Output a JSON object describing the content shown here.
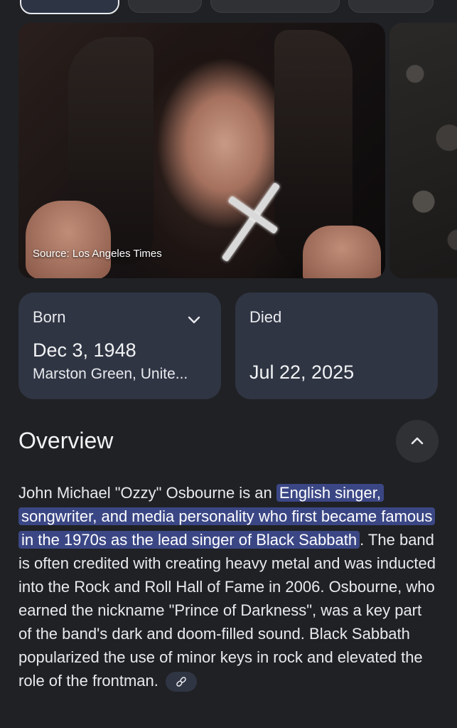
{
  "image": {
    "source_label": "Source: Los Angeles Times"
  },
  "facts": {
    "born": {
      "label": "Born",
      "date": "Dec 3, 1948",
      "place": "Marston Green, Unite..."
    },
    "died": {
      "label": "Died",
      "date": "Jul 22, 2025"
    }
  },
  "overview": {
    "title": "Overview",
    "text_before": "John Michael \"Ozzy\" Osbourne is an ",
    "highlight": "English singer, songwriter, and media personality who first became famous in the 1970s as the lead singer of Black Sabbath",
    "text_after": ". The band is often credited with creating heavy metal and was inducted into the Rock and Roll Hall of Fame in 2006. Osbourne, who earned the nickname \"Prince of Darkness\", was a key part of the band's dark and doom-filled sound. Black Sabbath popularized the use of minor keys in rock and elevated the role of the frontman."
  },
  "icons": {
    "expand": "chevron-down-icon",
    "collapse": "chevron-up-icon",
    "link": "link-icon"
  },
  "colors": {
    "background": "#202124",
    "card": "#303544",
    "highlight": "#3b4785"
  }
}
